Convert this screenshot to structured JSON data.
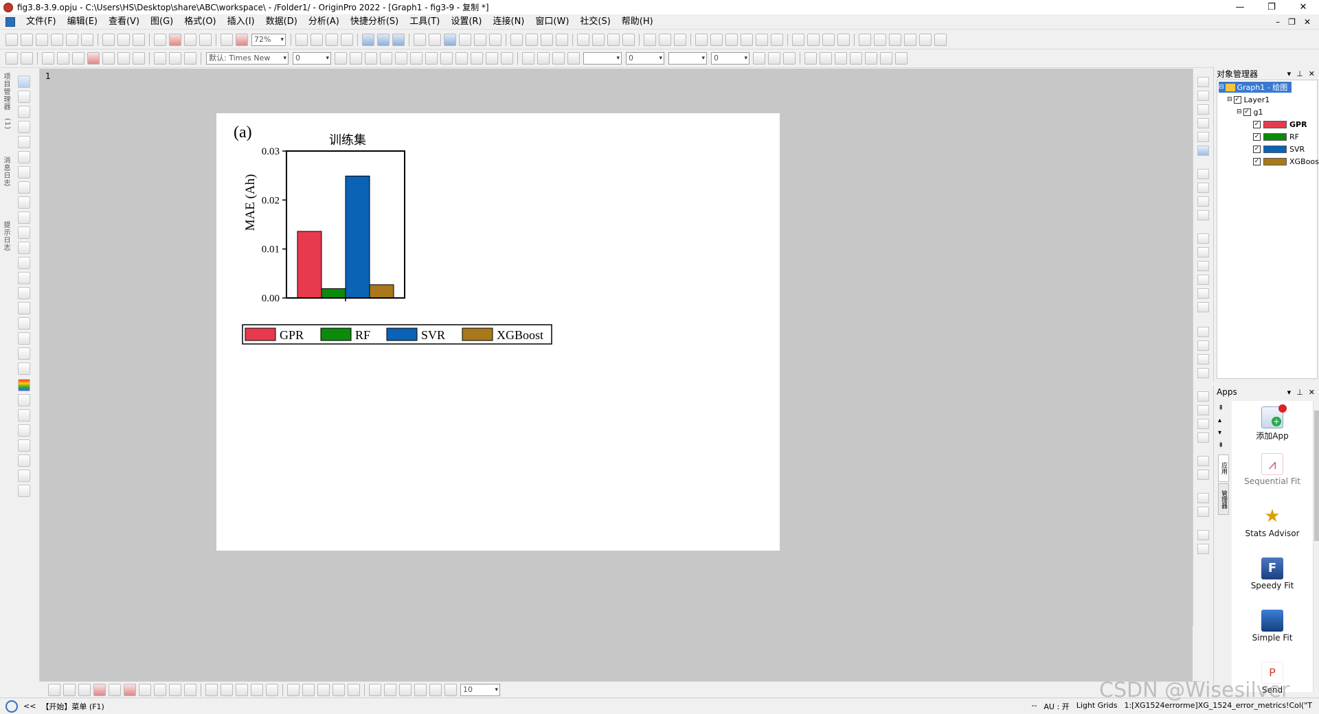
{
  "window": {
    "title": "fig3.8-3.9.opju - C:\\Users\\HS\\Desktop\\share\\ABC\\workspace\\ - /Folder1/ - OriginPro 2022 - [Graph1 - fig3-9 - 复制 *]",
    "minimize": "—",
    "restore": "❐",
    "close": "✕"
  },
  "menu": {
    "items": [
      "文件(F)",
      "编辑(E)",
      "查看(V)",
      "图(G)",
      "格式(O)",
      "插入(I)",
      "数据(D)",
      "分析(A)",
      "快捷分析(S)",
      "工具(T)",
      "设置(R)",
      "连接(N)",
      "窗口(W)",
      "社交(S)",
      "帮助(H)"
    ],
    "mdi_controls": [
      "–",
      "❐",
      "✕"
    ]
  },
  "toolbar": {
    "zoom": "72%",
    "font_name": "默认: Times New",
    "font_size": "0",
    "line_width": "0",
    "pattern_value": "0"
  },
  "left_tabs": [
    "项目管理器",
    "(1)",
    "消息日志",
    "提示日志"
  ],
  "workspace": {
    "page_index": "1"
  },
  "chart_data": {
    "type": "bar",
    "panel_label": "(a)",
    "title": "训练集",
    "ylabel": "MAE (Ah)",
    "xlabel": "",
    "ylim": [
      0,
      0.03
    ],
    "yticks": [
      "0.00",
      "0.01",
      "0.02",
      "0.03"
    ],
    "categories": [
      ""
    ],
    "series": [
      {
        "name": "GPR",
        "color": "#e83a4f",
        "values": [
          0.0136
        ]
      },
      {
        "name": "RF",
        "color": "#0c8a0c",
        "values": [
          0.0019
        ]
      },
      {
        "name": "SVR",
        "color": "#0a63b4",
        "values": [
          0.0249
        ]
      },
      {
        "name": "XGBoost",
        "color": "#a8781a",
        "values": [
          0.0027
        ]
      }
    ],
    "legend_position": "bottom"
  },
  "object_manager": {
    "title": "对象管理器",
    "graph": "Graph1 - 绘图",
    "layer": "Layer1",
    "group": "g1",
    "plots": [
      {
        "label": "GPR",
        "color": "#e83a4f"
      },
      {
        "label": "RF",
        "color": "#0c8a0c"
      },
      {
        "label": "SVR",
        "color": "#0a63b4"
      },
      {
        "label": "XGBoost",
        "color": "#a8781a"
      }
    ]
  },
  "apps": {
    "title": "Apps",
    "side_tabs": [
      "应用",
      "管理器"
    ],
    "items": [
      {
        "label": "添加App",
        "icon": "add-app-icon"
      },
      {
        "label": "Sequential Fit",
        "icon": "sequential-fit-icon"
      },
      {
        "label": "Stats Advisor",
        "icon": "stats-advisor-icon"
      },
      {
        "label": "Speedy Fit",
        "icon": "speedy-fit-icon"
      },
      {
        "label": "Simple Fit",
        "icon": "simple-fit-icon"
      },
      {
        "label": "Send",
        "icon": "send-icon"
      }
    ]
  },
  "bottom_toolbar": {
    "size_value": "10"
  },
  "status": {
    "left_arrows": "<<",
    "start_menu": "【开始】菜单 (F1)",
    "dots": "--",
    "au": "AU : 开",
    "grids": "Light Grids",
    "ref": "1:[XG1524errorme]XG_1524_error_metrics!Col(\"T"
  },
  "watermark": "CSDN @Wisesilver"
}
